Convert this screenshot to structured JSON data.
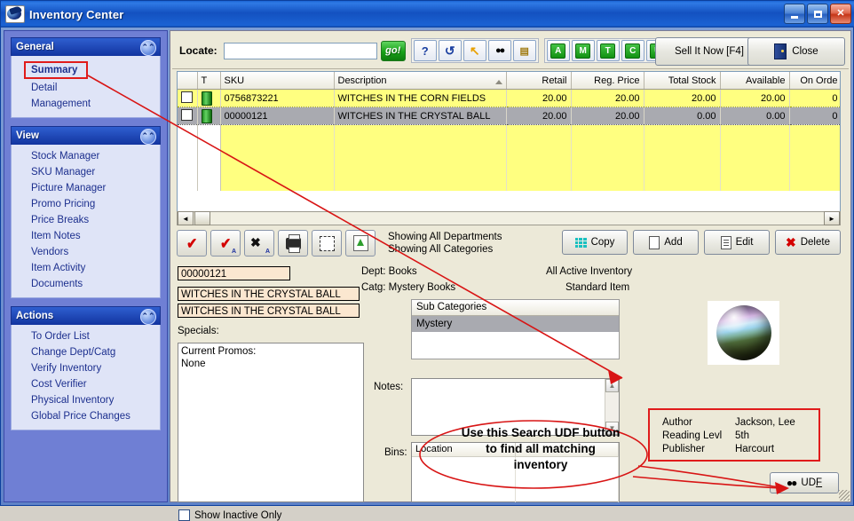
{
  "window": {
    "title": "Inventory Center",
    "icon": "app-icon",
    "minimize": "_",
    "maximize": "□",
    "close": "✕"
  },
  "sidebar": {
    "groups": [
      {
        "title": "General",
        "collapse_icon": "chevron-up-icon",
        "items": [
          {
            "label": "Summary",
            "selected": true
          },
          {
            "label": "Detail",
            "selected": false
          },
          {
            "label": "Management",
            "selected": false
          }
        ]
      },
      {
        "title": "View",
        "collapse_icon": "chevron-up-icon",
        "items": [
          {
            "label": "Stock Manager"
          },
          {
            "label": "SKU Manager"
          },
          {
            "label": "Picture Manager"
          },
          {
            "label": "Promo Pricing"
          },
          {
            "label": "Price Breaks"
          },
          {
            "label": "Item Notes"
          },
          {
            "label": "Vendors"
          },
          {
            "label": "Item Activity"
          },
          {
            "label": "Documents"
          }
        ]
      },
      {
        "title": "Actions",
        "collapse_icon": "chevron-up-icon",
        "items": [
          {
            "label": "To Order List"
          },
          {
            "label": "Change Dept/Catg"
          },
          {
            "label": "Verify Inventory"
          },
          {
            "label": "Cost Verifier"
          },
          {
            "label": "Physical Inventory"
          },
          {
            "label": "Global Price Changes"
          }
        ]
      }
    ]
  },
  "toolbar": {
    "locate_label": "Locate:",
    "locate_value": "",
    "locate_placeholder": "",
    "go_label": "go!",
    "icon_buttons": [
      {
        "name": "help-icon",
        "glyph": "?"
      },
      {
        "name": "refresh-icon",
        "glyph": "↻"
      },
      {
        "name": "jump-arrow-icon",
        "glyph": "↖"
      },
      {
        "name": "find-binoculars-icon",
        "glyph": "🔍"
      },
      {
        "name": "preview-page-icon",
        "glyph": "📄"
      }
    ],
    "letter_buttons": [
      "A",
      "M",
      "T",
      "C",
      "U"
    ],
    "sell_now_label": "Sell It Now [F4]",
    "close_label": "Close"
  },
  "grid": {
    "columns": [
      {
        "label": "",
        "align": "left"
      },
      {
        "label": "T",
        "align": "left"
      },
      {
        "label": "SKU",
        "align": "left"
      },
      {
        "label": "Description",
        "align": "left",
        "sorted": "asc"
      },
      {
        "label": "Retail",
        "align": "right"
      },
      {
        "label": "Reg. Price",
        "align": "right"
      },
      {
        "label": "Total Stock",
        "align": "right"
      },
      {
        "label": "Available",
        "align": "right"
      },
      {
        "label": "On Orde",
        "align": "right"
      }
    ],
    "rows": [
      {
        "checked": false,
        "type": "in-stock",
        "sku": "0756873221",
        "description": "WITCHES IN THE CORN FIELDS",
        "retail": "20.00",
        "reg_price": "20.00",
        "total_stock": "20.00",
        "available": "20.00",
        "on_order": "0",
        "selected": false
      },
      {
        "checked": false,
        "type": "in-stock",
        "sku": "00000121",
        "description": "WITCHES IN THE CRYSTAL BALL",
        "retail": "20.00",
        "reg_price": "20.00",
        "total_stock": "0.00",
        "available": "0.00",
        "on_order": "0",
        "selected": true
      }
    ],
    "scroll_left_glyph": "◄",
    "scroll_right_glyph": "►"
  },
  "actions": {
    "tool_buttons": [
      {
        "name": "check-button",
        "glyph": "✔"
      },
      {
        "name": "check-all-button",
        "glyph": "✔",
        "sub": "A"
      },
      {
        "name": "uncheck-all-button",
        "glyph": "✘",
        "sub": "A"
      },
      {
        "name": "print-button",
        "glyph": "printer"
      },
      {
        "name": "grid-button",
        "glyph": "sheet"
      },
      {
        "name": "export-button",
        "glyph": "up-arrow"
      }
    ],
    "showing_departments": "Showing All Departments",
    "showing_categories": "Showing All Categories",
    "copy_label": "Copy",
    "add_label": "Add",
    "edit_label": "Edit",
    "delete_label": "Delete"
  },
  "detail": {
    "sku": "00000121",
    "description1": "WITCHES IN THE CRYSTAL BALL",
    "description2": "WITCHES IN THE CRYSTAL BALL",
    "specials_label": "Specials:",
    "promos_text": "Current Promos:\n None",
    "show_inactive_label": "Show Inactive Only",
    "show_inactive_checked": false,
    "dept_line": "Dept: Books",
    "catg_line": "Catg: Mystery Books",
    "all_active": "All Active Inventory",
    "standard_item": "Standard Item",
    "subcategories_header": "Sub Categories",
    "subcategories_selected": "Mystery",
    "notes_label": "Notes:",
    "notes_value": "",
    "bins_label": "Bins:",
    "bins_column": "Location",
    "picture_name": "item-thumbnail",
    "udf": {
      "rows": [
        {
          "key": "Author",
          "value": "Jackson, Lee"
        },
        {
          "key": "Reading Levl",
          "value": "5th"
        },
        {
          "key": "Publisher",
          "value": "Harcourt"
        }
      ],
      "button_label_pre": "UD",
      "button_label_underlined": "F",
      "button_icon": "binoculars-icon"
    }
  },
  "annotation": {
    "callout_line1": "Use this Search UDF button",
    "callout_line2": "to find all matching",
    "callout_line3": "inventory",
    "color": "#d81414"
  }
}
